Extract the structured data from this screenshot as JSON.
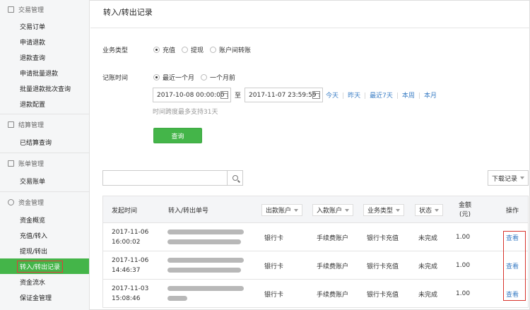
{
  "sidebar": {
    "groups": [
      {
        "title": "交易管理",
        "icon": "trade-icon",
        "items": [
          "交易订单",
          "申请退款",
          "退款查询",
          "申请批量退款",
          "批量退款批次查询",
          "退款配置"
        ]
      },
      {
        "title": "结算管理",
        "icon": "settlement-icon",
        "items": [
          "已结算查询"
        ]
      },
      {
        "title": "账单管理",
        "icon": "bill-icon",
        "items": [
          "交易账单"
        ]
      },
      {
        "title": "资金管理",
        "icon": "coin-bag-icon",
        "items": [
          "资金概览",
          "充值/转入",
          "提现/转出",
          "转入/转出记录",
          "资金流水",
          "保证金管理"
        ]
      }
    ],
    "active_item": "转入/转出记录"
  },
  "page": {
    "title": "转入/转出记录"
  },
  "filters": {
    "biz_type_label": "业务类型",
    "biz_types": [
      "充值",
      "提现",
      "账户间转账"
    ],
    "biz_type_selected": "充值",
    "time_label": "记账时间",
    "time_ranges": [
      "最近一个月",
      "一个月前"
    ],
    "time_range_selected": "最近一个月",
    "start": "2017-10-08 00:00:00",
    "to": "至",
    "end": "2017-11-07 23:59:59",
    "quick": [
      "今天",
      "昨天",
      "最近7天",
      "本周",
      "本月"
    ],
    "hint": "时间跨度最多支持31天",
    "query_label": "查询"
  },
  "toolbar": {
    "search_placeholder": "",
    "download_label": "下载记录"
  },
  "table": {
    "headers": {
      "time": "发起时间",
      "order_no": "转入/转出单号",
      "out_account": "出款账户",
      "in_account": "入款账户",
      "biz_type": "业务类型",
      "status": "状态",
      "amount_line1": "金额",
      "amount_line2": "(元)",
      "op": "操作"
    },
    "rows": [
      {
        "date": "2017-11-06",
        "time": "16:00:02",
        "out": "银行卡",
        "in": "手续费账户",
        "biz": "银行卡充值",
        "status": "未完成",
        "amount": "1.00",
        "op": "查看"
      },
      {
        "date": "2017-11-06",
        "time": "14:46:37",
        "out": "银行卡",
        "in": "手续费账户",
        "biz": "银行卡充值",
        "status": "未完成",
        "amount": "1.00",
        "op": "查看"
      },
      {
        "date": "2017-11-03",
        "time": "15:08:46",
        "out": "银行卡",
        "in": "手续费账户",
        "biz": "银行卡充值",
        "status": "未完成",
        "amount": "1.00",
        "op": "查看"
      }
    ]
  },
  "colors": {
    "accent": "#44b549",
    "link": "#3b7ec5",
    "highlight": "#d8342c"
  }
}
